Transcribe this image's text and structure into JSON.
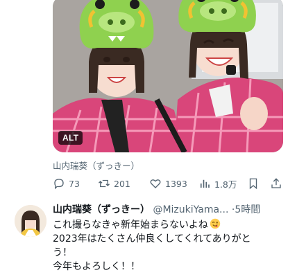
{
  "media": {
    "alt_badge": "ALT"
  },
  "caption": {
    "author": "山内瑞葵（ずっきー）"
  },
  "actions": {
    "reply_count": "73",
    "retweet_count": "201",
    "like_count": "1393",
    "view_count": "1.8万"
  },
  "tweet": {
    "display_name": "山内瑞葵（ずっきー）",
    "handle": "@MizukiYama...",
    "separator": "·",
    "time": "5時間",
    "lines": [
      "これ撮らなきゃ新年始まらないよね",
      "2023年はたくさん仲良くしてくれてありがと",
      "う！",
      "今年もよろしく！！"
    ],
    "emoji": "winking-face-emoji"
  },
  "colors": {
    "text": "#0f1419",
    "secondary": "#536471",
    "hat_green": "#8fd14f",
    "uniform_pink": "#e0457b"
  }
}
